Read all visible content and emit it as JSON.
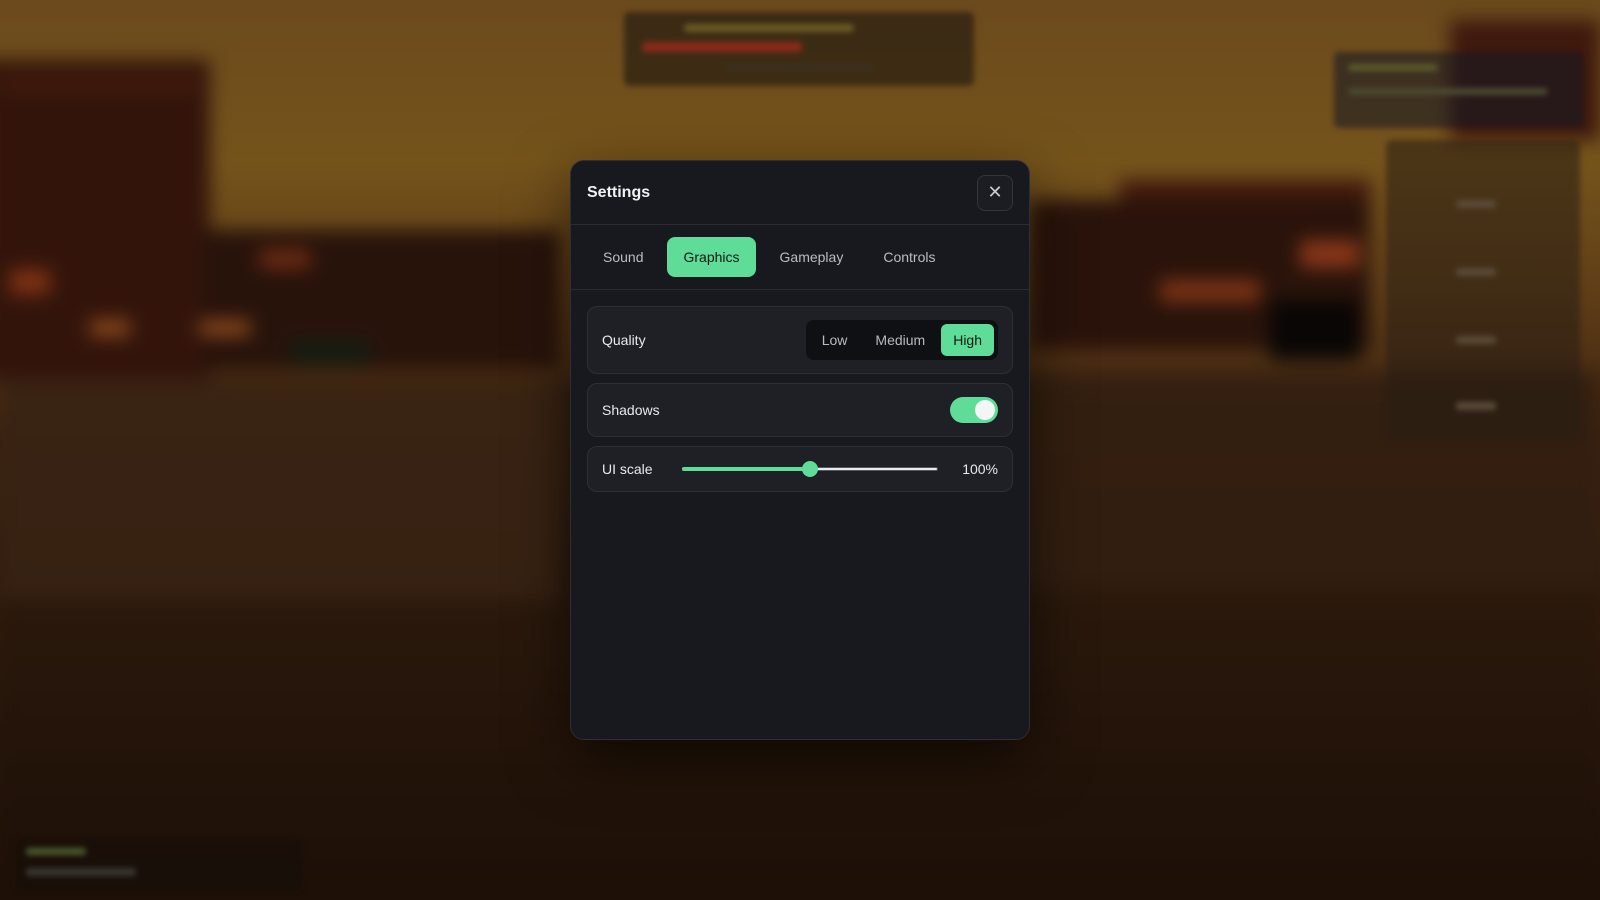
{
  "modal": {
    "title": "Settings",
    "close_icon": "close-icon",
    "tabs": [
      {
        "label": "Sound",
        "active": false
      },
      {
        "label": "Graphics",
        "active": true
      },
      {
        "label": "Gameplay",
        "active": false
      },
      {
        "label": "Controls",
        "active": false
      }
    ],
    "quality": {
      "label": "Quality",
      "options": [
        "Low",
        "Medium",
        "High"
      ],
      "selected": "High"
    },
    "shadows": {
      "label": "Shadows",
      "enabled": true
    },
    "ui_scale": {
      "label": "UI scale",
      "value_text": "100%",
      "slider_fraction": 0.5
    }
  },
  "colors": {
    "accent": "#5fdc98",
    "panel": "#17191e",
    "row": "#1e2026"
  }
}
